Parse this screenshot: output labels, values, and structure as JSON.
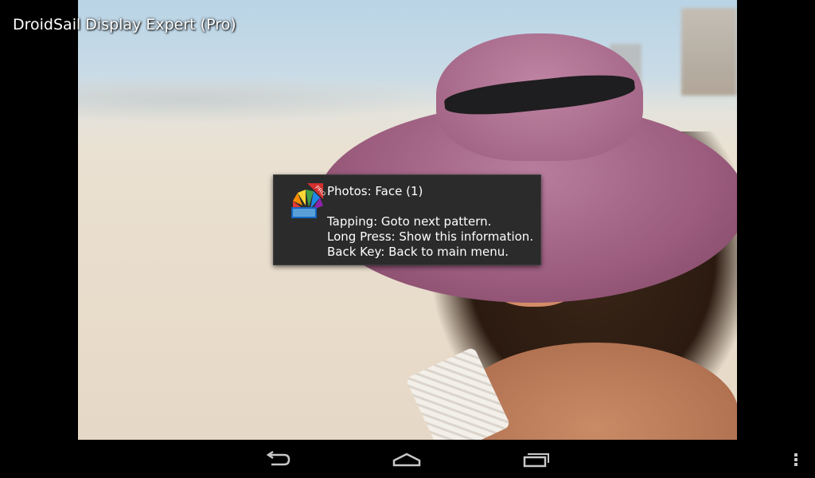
{
  "app": {
    "title": "DroidSail Display Expert (Pro)"
  },
  "toast": {
    "icon": "color-fan-pro-icon",
    "badge": "PRO",
    "title": "Photos: Face (1)",
    "lines": [
      "Tapping: Goto next pattern.",
      "Long Press: Show this information.",
      "Back Key: Back to main menu."
    ]
  },
  "navigation_bar": {
    "buttons": [
      {
        "name": "back",
        "icon": "back-arrow-icon"
      },
      {
        "name": "home",
        "icon": "home-icon"
      },
      {
        "name": "recents",
        "icon": "recent-apps-icon"
      }
    ],
    "menu_icon": "overflow-menu-icon"
  },
  "colors": {
    "toast_background": "#2b2b2b",
    "text": "#ffffff",
    "nav_icon": "#c8c8c8"
  }
}
